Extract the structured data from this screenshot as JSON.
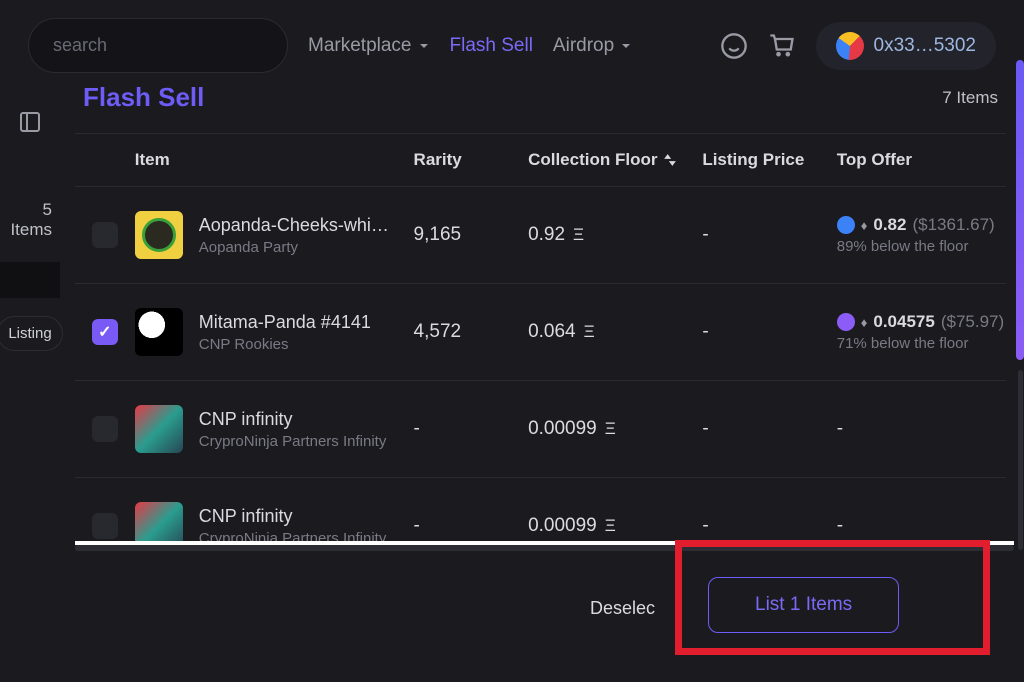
{
  "header": {
    "search_placeholder": "search",
    "nav": {
      "marketplace": "Marketplace",
      "flash_sell": "Flash Sell",
      "airdrop": "Airdrop"
    },
    "wallet": "0x33…5302"
  },
  "sidebar": {
    "items_count": "5 Items",
    "listing": "Listing"
  },
  "page": {
    "title": "Flash Sell",
    "total": "7 Items"
  },
  "columns": {
    "item": "Item",
    "rarity": "Rarity",
    "floor": "Collection Floor",
    "listing": "Listing Price",
    "offer": "Top Offer"
  },
  "rows": [
    {
      "checked": false,
      "name": "Aopanda-Cheeks-whi…",
      "collection": "Aopanda Party",
      "rarity": "9,165",
      "floor": "0.92",
      "listing": "-",
      "offer": {
        "val": "0.82",
        "usd": "($1361.67)",
        "below": "89% below the floor",
        "badge": "blue"
      }
    },
    {
      "checked": true,
      "name": "Mitama-Panda #4141",
      "collection": "CNP Rookies",
      "rarity": "4,572",
      "floor": "0.064",
      "listing": "-",
      "offer": {
        "val": "0.04575",
        "usd": "($75.97)",
        "below": "71% below the floor",
        "badge": "purple"
      }
    },
    {
      "checked": false,
      "name": "CNP infinity",
      "collection": "CryproNinja Partners Infinity",
      "rarity": "-",
      "floor": "0.00099",
      "listing": "-",
      "offer": null
    },
    {
      "checked": false,
      "name": "CNP infinity",
      "collection": "CryproNinja Partners Infinity",
      "rarity": "-",
      "floor": "0.00099",
      "listing": "-",
      "offer": null
    }
  ],
  "footer": {
    "deselect": "Deselec",
    "list_button": "List 1 Items"
  }
}
